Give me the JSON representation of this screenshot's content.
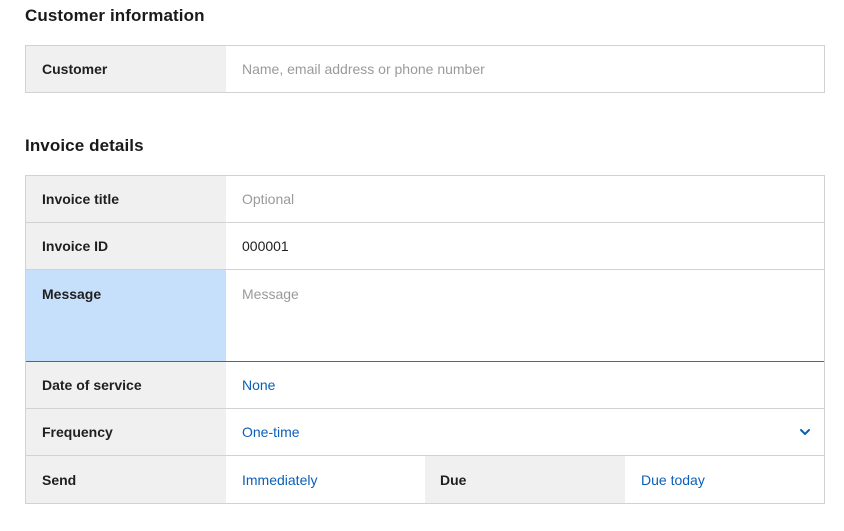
{
  "sections": {
    "customer_title": "Customer information",
    "invoice_title": "Invoice details"
  },
  "customer": {
    "label": "Customer",
    "placeholder": "Name, email address or phone number"
  },
  "invoice": {
    "title_label": "Invoice title",
    "title_placeholder": "Optional",
    "id_label": "Invoice ID",
    "id_value": "000001",
    "message_label": "Message",
    "message_placeholder": "Message",
    "date_label": "Date of service",
    "date_value": "None",
    "frequency_label": "Frequency",
    "frequency_value": "One-time",
    "send_label": "Send",
    "send_value": "Immediately",
    "due_label": "Due",
    "due_value": "Due today"
  },
  "icons": {
    "frequency_dropdown": "chevron-down-icon"
  },
  "colors": {
    "link": "#0b5fb8",
    "label_bg": "#f0f0f0",
    "focus_bg": "#c6dffb",
    "placeholder": "#9a9a9a",
    "border": "#d2d2d2"
  }
}
